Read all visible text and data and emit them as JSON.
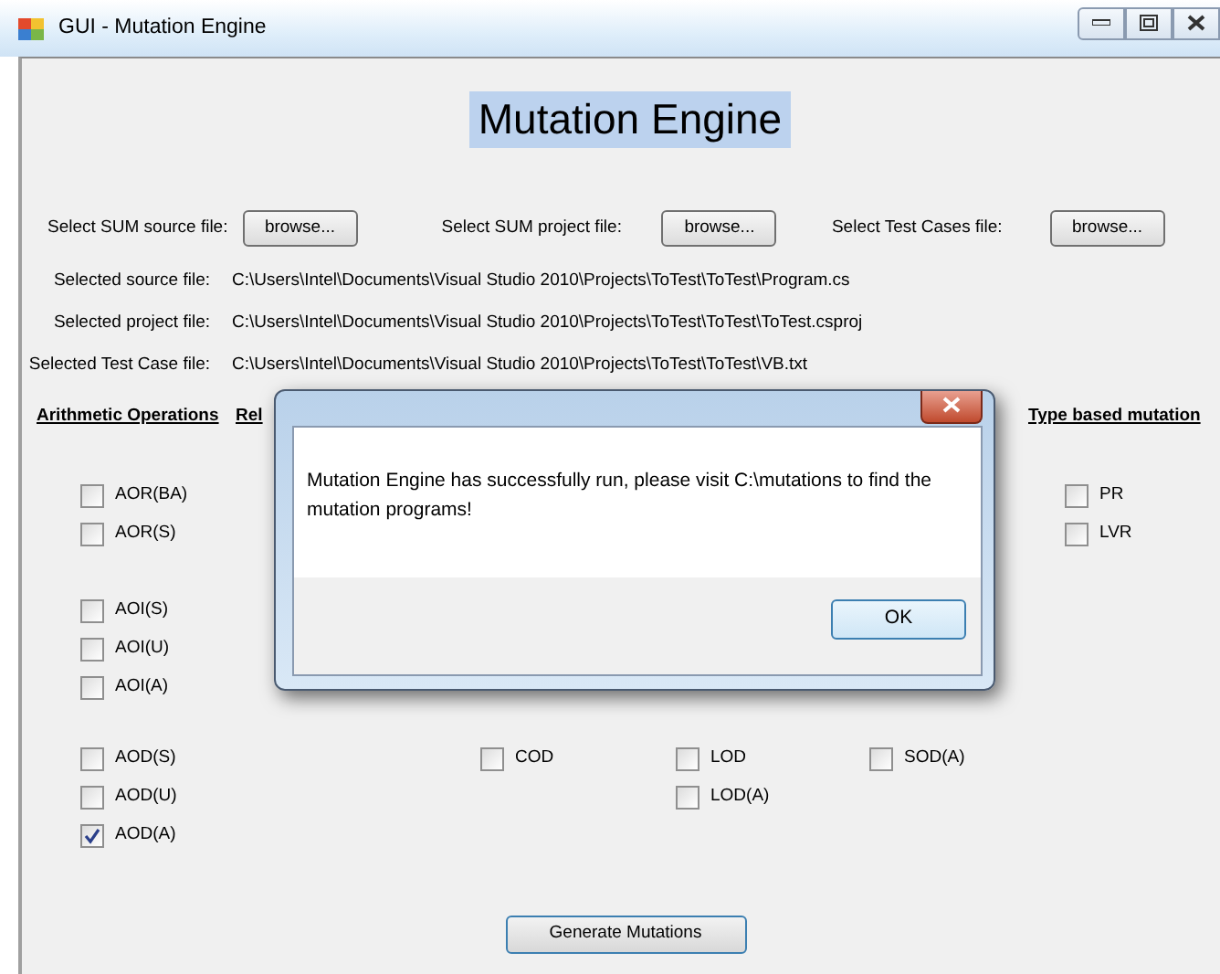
{
  "window": {
    "title": "GUI - Mutation Engine"
  },
  "heading": "Mutation Engine",
  "file_pickers": [
    {
      "label": "Select SUM source file:",
      "button": "browse..."
    },
    {
      "label": "Select SUM project file:",
      "button": "browse..."
    },
    {
      "label": "Select Test Cases file:",
      "button": "browse..."
    }
  ],
  "selected_files": [
    {
      "label": "Selected source file:",
      "path": "C:\\Users\\Intel\\Documents\\Visual Studio 2010\\Projects\\ToTest\\ToTest\\Program.cs"
    },
    {
      "label": "Selected project file:",
      "path": "C:\\Users\\Intel\\Documents\\Visual Studio 2010\\Projects\\ToTest\\ToTest\\ToTest.csproj"
    },
    {
      "label": "Selected Test Case file:",
      "path": "C:\\Users\\Intel\\Documents\\Visual Studio 2010\\Projects\\ToTest\\ToTest\\VB.txt"
    }
  ],
  "column_headings": [
    {
      "kind": "arithmetic",
      "text": "Arithmetic Operations"
    },
    {
      "kind": "relational",
      "text": "Rel"
    },
    {
      "kind": "type",
      "text": "Type based mutation"
    }
  ],
  "option_bands": [
    {
      "options": [
        {
          "kind": "arithmetic",
          "label": "AOR(BA)",
          "checked": false
        },
        {
          "kind": "type",
          "label": "PR",
          "checked": false
        },
        {
          "kind": "arithmetic",
          "label": "AOR(S)",
          "checked": false
        },
        {
          "kind": "type",
          "label": "LVR",
          "checked": false
        }
      ]
    },
    {
      "options": [
        {
          "kind": "arithmetic",
          "label": "AOI(S)",
          "checked": false
        },
        {
          "kind": "arithmetic",
          "label": "AOI(U)",
          "checked": false
        },
        {
          "kind": "arithmetic",
          "label": "AOI(A)",
          "checked": false
        }
      ]
    },
    {
      "options": [
        {
          "kind": "arithmetic",
          "label": "AOD(S)",
          "checked": false
        },
        {
          "kind": "conditional",
          "label": "COD",
          "checked": false
        },
        {
          "kind": "logical",
          "label": "LOD",
          "checked": false
        },
        {
          "kind": "shift",
          "label": "SOD(A)",
          "checked": false
        },
        {
          "kind": "arithmetic",
          "label": "AOD(U)",
          "checked": false
        },
        {
          "kind": "logical",
          "label": "LOD(A)",
          "checked": false
        },
        {
          "kind": "arithmetic",
          "label": "AOD(A)",
          "checked": true
        }
      ]
    }
  ],
  "generate_button": "Generate Mutations",
  "dialog": {
    "message": "Mutation Engine has successfully run, please visit C:\\mutations to find the mutation programs!",
    "button": "OK"
  }
}
